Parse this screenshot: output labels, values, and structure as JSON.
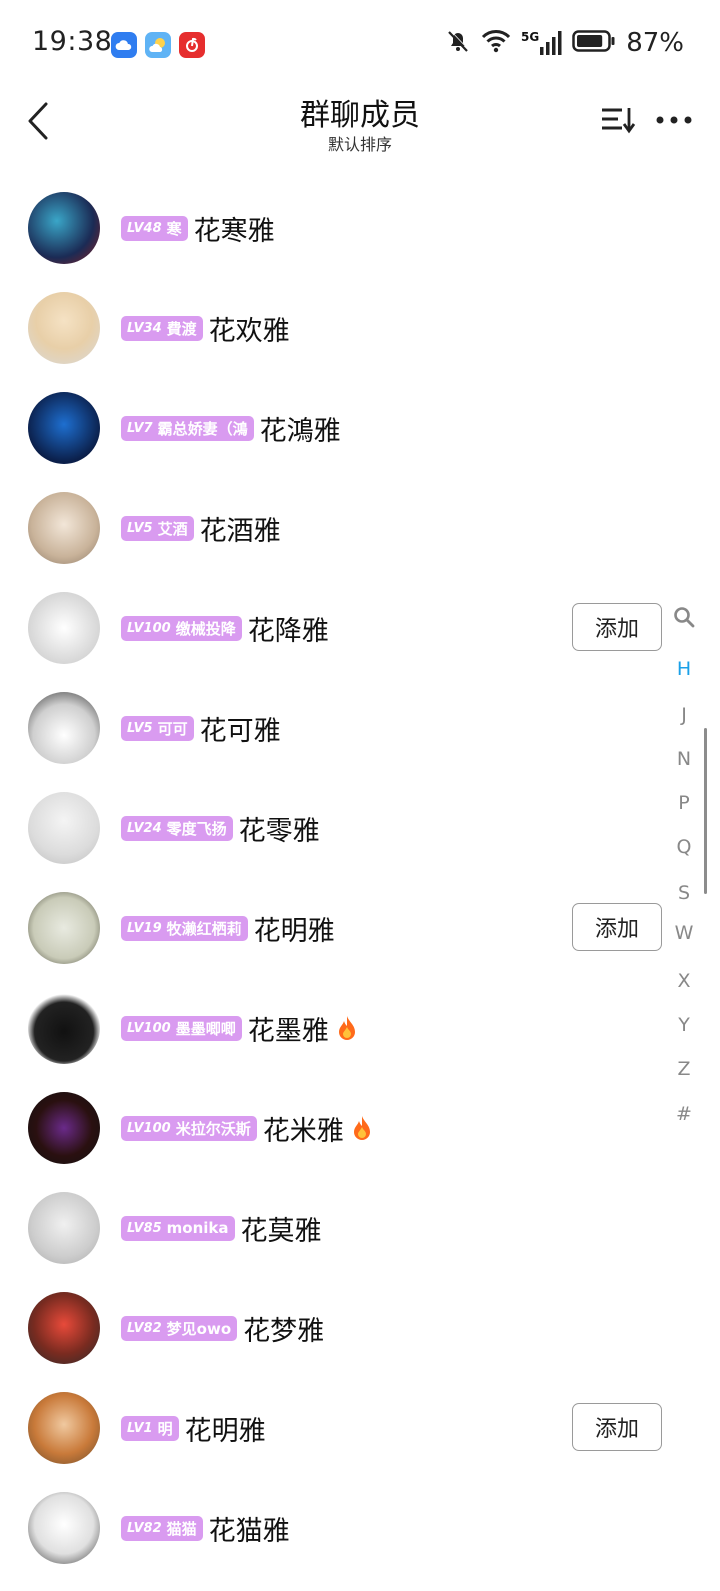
{
  "status_bar": {
    "time": "19:38",
    "battery": "87%",
    "network": "5G",
    "icons": [
      "cloud-app-icon",
      "weather-app-icon",
      "netease-music-icon",
      "mute-bell-icon",
      "wifi-icon",
      "signal-icon",
      "battery-icon"
    ],
    "battery_level": 0.87
  },
  "header": {
    "title": "群聊成员",
    "subtitle": "默认排序"
  },
  "add_label": "添加",
  "members": [
    {
      "lv": "LV48",
      "title": "寒",
      "name": "花寒雅",
      "add": false,
      "fire": false
    },
    {
      "lv": "LV34",
      "title": "費渡",
      "name": "花欢雅",
      "add": false,
      "fire": false
    },
    {
      "lv": "LV7",
      "title": "霸总娇妻（鴻",
      "name": "花鴻雅",
      "add": false,
      "fire": false
    },
    {
      "lv": "LV5",
      "title": "艾酒",
      "name": "花酒雅",
      "add": false,
      "fire": false
    },
    {
      "lv": "LV100",
      "title": "缴械投降",
      "name": "花降雅",
      "add": true,
      "fire": false
    },
    {
      "lv": "LV5",
      "title": "可可",
      "name": "花可雅",
      "add": false,
      "fire": false
    },
    {
      "lv": "LV24",
      "title": "零度飞扬",
      "name": "花零雅",
      "add": false,
      "fire": false
    },
    {
      "lv": "LV19",
      "title": "牧濑红栖莉",
      "name": "花明雅",
      "add": true,
      "fire": false
    },
    {
      "lv": "LV100",
      "title": "墨墨唧唧",
      "name": "花墨雅",
      "add": false,
      "fire": true
    },
    {
      "lv": "LV100",
      "title": "米拉尔沃斯",
      "name": "花米雅",
      "add": false,
      "fire": true
    },
    {
      "lv": "LV85",
      "title": "monika",
      "name": "花莫雅",
      "add": false,
      "fire": false
    },
    {
      "lv": "LV82",
      "title": "梦见owo",
      "name": "花梦雅",
      "add": false,
      "fire": false
    },
    {
      "lv": "LV1",
      "title": "明",
      "name": "花明雅",
      "add": true,
      "fire": false
    },
    {
      "lv": "LV82",
      "title": "猫猫",
      "name": "花猫雅",
      "add": false,
      "fire": false
    }
  ],
  "index_bar": [
    "H",
    "J",
    "N",
    "P",
    "Q",
    "S",
    "W",
    "X",
    "Y",
    "Z",
    "#"
  ],
  "index_active": "H",
  "colors": {
    "badge": "#d99bf0",
    "index_active": "#1aa0e8",
    "fire": "#ff6a1a"
  }
}
